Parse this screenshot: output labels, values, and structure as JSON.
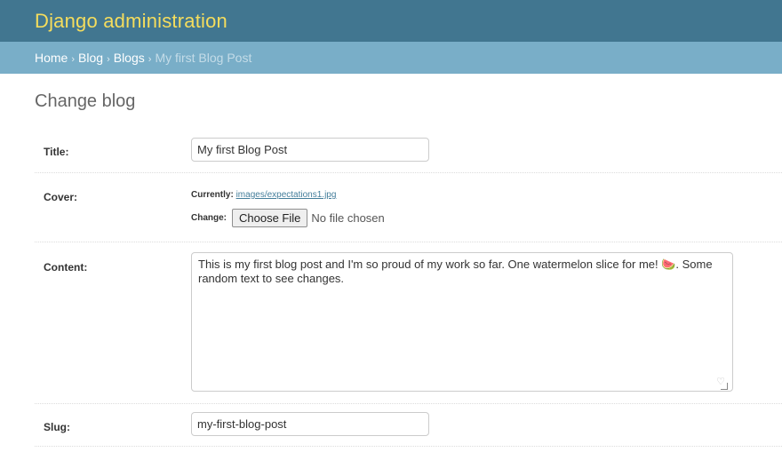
{
  "header": {
    "site_name": "Django administration"
  },
  "breadcrumbs": {
    "items": [
      "Home",
      "Blog",
      "Blogs"
    ],
    "separator": "›",
    "current": "My first Blog Post"
  },
  "page": {
    "title": "Change blog"
  },
  "form": {
    "title": {
      "label": "Title:",
      "value": "My first Blog Post"
    },
    "cover": {
      "label": "Cover:",
      "currently_label": "Currently:",
      "currently_value": "images/expectations1.jpg",
      "change_label": "Change:",
      "button_label": "Choose File",
      "status": "No file chosen"
    },
    "content": {
      "label": "Content:",
      "value": "This is my first blog post and I'm so proud of my work so far. One watermelon slice for me! 🍉. Some random text to see changes."
    },
    "slug": {
      "label": "Slug:",
      "value": "my-first-blog-post"
    }
  },
  "colors": {
    "header_bg": "#417690",
    "site_name": "#f5dd5d",
    "breadcrumbs_bg": "#79aec8",
    "link": "#447e9b"
  }
}
